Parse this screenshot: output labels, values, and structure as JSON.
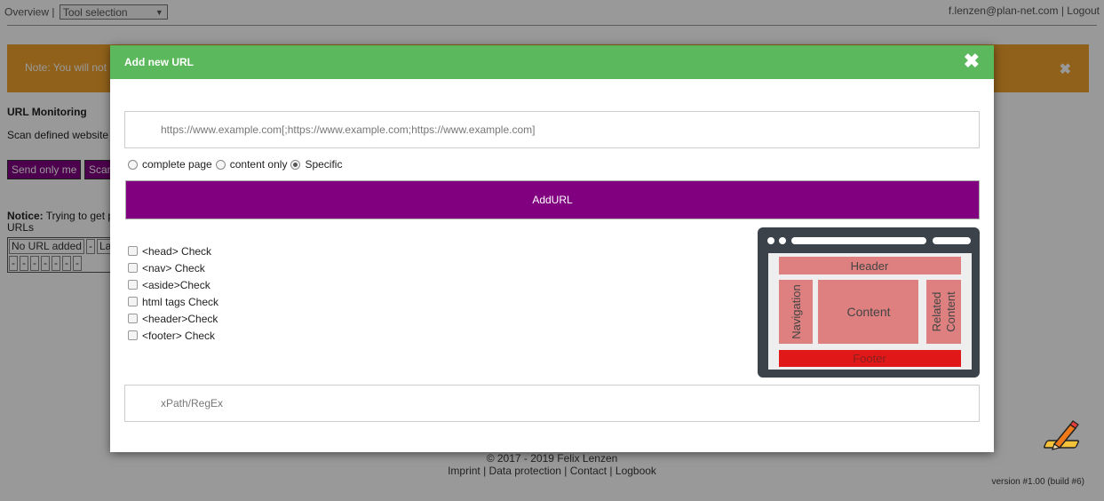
{
  "header": {
    "overview_label": "Overview",
    "separator": "|",
    "tool_select_value": "Tool selection",
    "user_email": "f.lenzen@plan-net.com",
    "logout_label": "Logout"
  },
  "warning": {
    "text": "Note: You will not",
    "close_glyph": "✖"
  },
  "page": {
    "section_title": "URL Monitoring",
    "section_sub": "Scan defined website",
    "send_only_me_label": "Send only me",
    "scan_label": "Scan",
    "notice_bold": "Notice:",
    "notice_text": " Trying to get p",
    "notice_line2": "URLs",
    "table_row1": [
      "No URL added",
      "-",
      "La"
    ],
    "table_row2": [
      "-",
      "-",
      "-",
      "-",
      "-",
      "-",
      "-"
    ]
  },
  "footer": {
    "copyright": "© 2017 - 2019 Felix Lenzen",
    "links": [
      "Imprint",
      "Data protection",
      "Contact",
      "Logbook"
    ],
    "version": "version #1.00 (build #6)"
  },
  "modal": {
    "title": "Add new URL",
    "close_glyph": "✖",
    "url_placeholder": "https://www.example.com[;https://www.example.com;https://www.example.com]",
    "radio_options": [
      {
        "label": "complete page",
        "checked": false
      },
      {
        "label": "content only",
        "checked": false
      },
      {
        "label": "Specific",
        "checked": true
      }
    ],
    "add_button_label": "AddURL",
    "checkboxes": [
      "<head> Check",
      "<nav> Check",
      "<aside>Check",
      "html tags Check",
      "<header>Check",
      "<footer> Check"
    ],
    "diagram": {
      "header": "Header",
      "navigation": "Navigation",
      "content": "Content",
      "related_line1": "Related",
      "related_line2": "Content",
      "footer": "Footer"
    },
    "xpath_placeholder": "xPath/RegEx"
  },
  "colors": {
    "modal_header": "#5cb85c",
    "primary_button": "#800080",
    "warning_bar": "#f0a22c",
    "diagram_frame": "#3b424a",
    "diagram_block": "#de8080",
    "diagram_footer": "#e01818"
  }
}
